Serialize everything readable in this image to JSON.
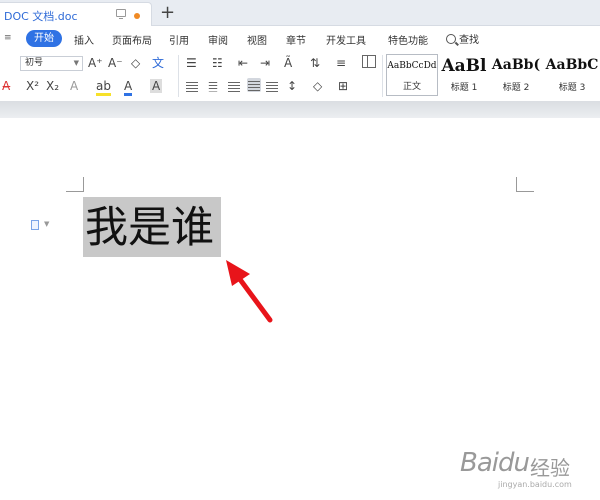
{
  "tabbar": {
    "doc_title": "DOC 文档.doc",
    "new_tab_label": "+"
  },
  "menubar": {
    "chevron": "≡",
    "items": [
      "开始",
      "插入",
      "页面布局",
      "引用",
      "审阅",
      "视图",
      "章节",
      "开发工具",
      "特色功能"
    ],
    "search_label": "查找"
  },
  "ribbon": {
    "font_size_value": "初号",
    "font_grow": "A⁺",
    "font_shrink": "A⁻",
    "clear_format": "◇",
    "pinyin": "文",
    "superscript": "X²",
    "subscript": "X₂",
    "font_effect": "A",
    "highlight": "ab",
    "font_color": "A",
    "char_shade": "A",
    "styles": [
      {
        "sample": "AaBbCcDd",
        "name": "正文"
      },
      {
        "sample": "AaBl",
        "name": "标题 1"
      },
      {
        "sample": "AaBb(",
        "name": "标题 2"
      },
      {
        "sample": "AaBbC",
        "name": "标题 3"
      }
    ]
  },
  "document": {
    "selected_text": "我是谁"
  },
  "watermark": {
    "brand": "Baidu",
    "suffix": "经验",
    "url": "jingyan.baidu.com"
  },
  "colors": {
    "accent": "#2f72e4",
    "tab_title": "#2f6bd7",
    "arrow": "#e8141a",
    "selection": "#c8c8c8"
  }
}
